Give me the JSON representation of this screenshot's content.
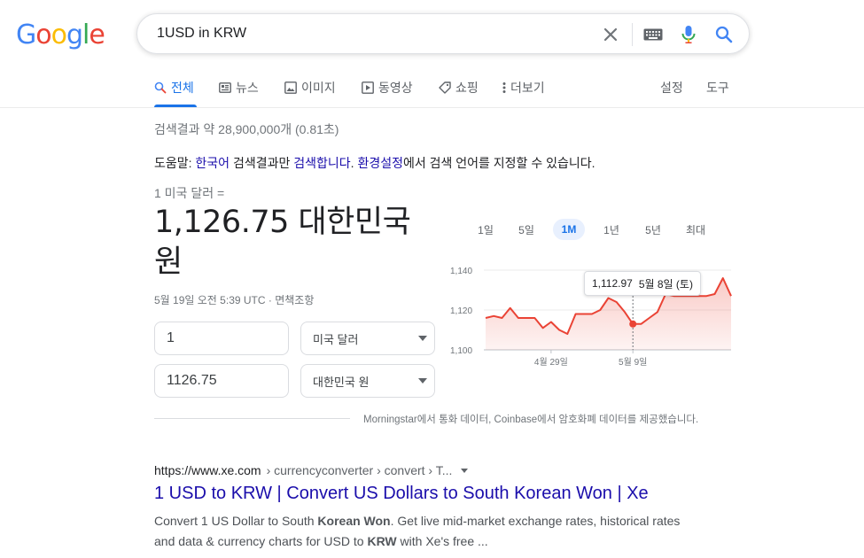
{
  "header": {
    "logo_letters": [
      {
        "ch": "G",
        "color": "#4285F4"
      },
      {
        "ch": "o",
        "color": "#EA4335"
      },
      {
        "ch": "o",
        "color": "#FBBC05"
      },
      {
        "ch": "g",
        "color": "#4285F4"
      },
      {
        "ch": "l",
        "color": "#34A853"
      },
      {
        "ch": "e",
        "color": "#EA4335"
      }
    ],
    "search_query": "1USD in KRW",
    "icons": [
      "clear-icon",
      "keyboard-icon",
      "mic-icon",
      "search-icon"
    ]
  },
  "tabs": {
    "all": "전체",
    "news": "뉴스",
    "images": "이미지",
    "videos": "동영상",
    "shopping": "쇼핑",
    "more": "더보기",
    "settings": "설정",
    "tools": "도구"
  },
  "stats": "검색결과 약 28,900,000개 (0.81초)",
  "tip": {
    "prefix": "도움말: ",
    "lang_link": "한국어",
    "mid1": " 검색결과만 ",
    "search_link": "검색합니다",
    "mid2": ". ",
    "settings_link": "환경설정",
    "suffix": "에서 검색 언어를 지정할 수 있습니다."
  },
  "converter": {
    "from_text": "1 미국 달러 =",
    "result_line1": "1,126.75 대한민국",
    "result_line2": "원",
    "time_text": "5월 19일 오전 5:39 UTC · ",
    "disclaimer": "면책조항",
    "amount_from": "1",
    "currency_from": "미국 달러",
    "amount_to": "1126.75",
    "currency_to": "대한민국 원",
    "source": "Morningstar에서 통화 데이터, Coinbase에서 암호화폐 데이터를 제공했습니다."
  },
  "chart_ranges": [
    "1일",
    "5일",
    "1M",
    "1년",
    "5년",
    "최대"
  ],
  "active_range": "1M",
  "tooltip": {
    "value": "1,112.97",
    "date": "5월 8일 (토)"
  },
  "colors": {
    "accent": "#1a73e8",
    "line": "#ea4335",
    "link": "#1a0dab"
  },
  "chart_data": {
    "type": "area",
    "ylim": [
      1100,
      1140
    ],
    "yticks": [
      "1,140",
      "1,120",
      "1,100"
    ],
    "ytick_values": [
      1140,
      1120,
      1100
    ],
    "xticks": [
      "4월 29일",
      "5월 9일"
    ],
    "xtick_index": [
      8,
      18
    ],
    "grid": true,
    "values": [
      1116,
      1117,
      1116,
      1121,
      1116,
      1116,
      1116,
      1111,
      1114,
      1110,
      1108,
      1118,
      1118,
      1118,
      1120,
      1126,
      1124,
      1119,
      1113,
      1113,
      1116,
      1119,
      1128,
      1127,
      1127,
      1127,
      1127,
      1127,
      1128,
      1136,
      1127
    ],
    "highlight_index": 18
  },
  "result": {
    "domain": "https://www.xe.com",
    "path": " › currencyconverter › convert › T...",
    "title": "1 USD to KRW | Convert US Dollars to South Korean Won | Xe",
    "snippet_a": "Convert 1 US Dollar to South ",
    "snippet_b1": "Korean Won",
    "snippet_c": ". Get live mid-market exchange rates, historical rates and data & currency charts for USD to ",
    "snippet_b2": "KRW",
    "snippet_d": " with Xe's free ..."
  }
}
